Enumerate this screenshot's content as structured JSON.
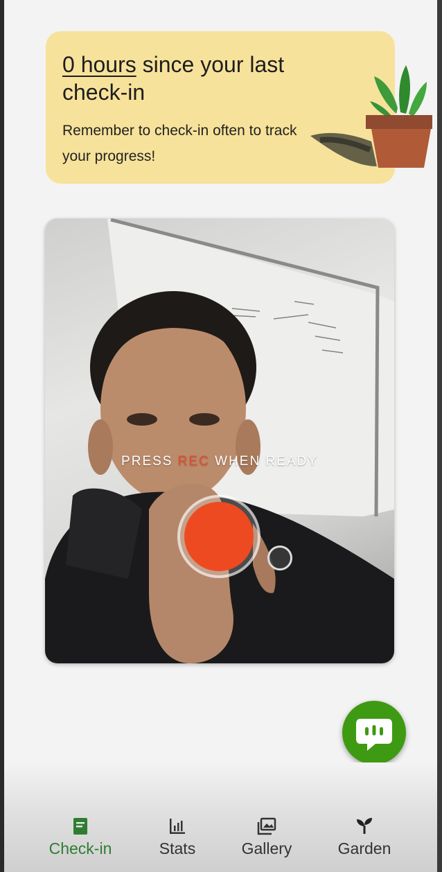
{
  "banner": {
    "hours": "0 hours",
    "title_rest": "since your last check-in",
    "message": "Remember to check-in often to track your progress!"
  },
  "camera": {
    "prompt_before": "PRESS ",
    "prompt_rec": "REC",
    "prompt_after": " WHEN READY"
  },
  "fab": {
    "icon": "chat-bubble-icon"
  },
  "nav": {
    "items": [
      {
        "label": "Check-in",
        "icon": "book-icon",
        "active": true
      },
      {
        "label": "Stats",
        "icon": "bar-chart-icon",
        "active": false
      },
      {
        "label": "Gallery",
        "icon": "image-icon",
        "active": false
      },
      {
        "label": "Garden",
        "icon": "sprout-icon",
        "active": false
      }
    ]
  },
  "colors": {
    "banner_bg": "#f7e29b",
    "rec": "#ee4a21",
    "fab": "#3f9a13",
    "nav_active": "#2e7d32"
  }
}
